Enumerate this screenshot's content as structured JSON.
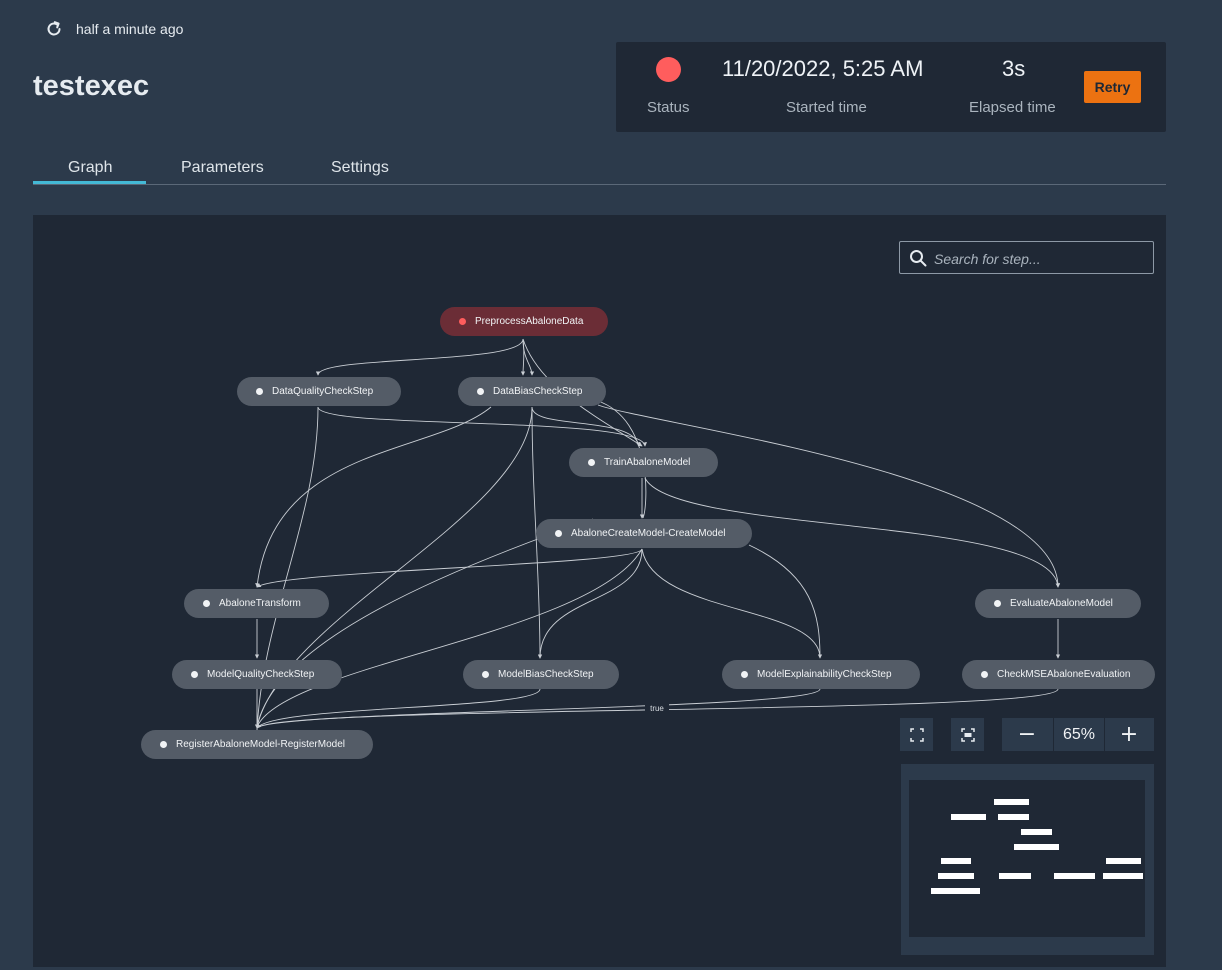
{
  "header": {
    "refresh_label": "half a minute ago",
    "title": "testexec"
  },
  "status_panel": {
    "status_label": "Status",
    "status_color": "#ff5d5d",
    "started_value": "11/20/2022, 5:25 AM",
    "started_label": "Started time",
    "elapsed_value": "3s",
    "elapsed_label": "Elapsed time",
    "retry_label": "Retry",
    "retry_color": "#ec7211"
  },
  "tabs": [
    {
      "label": "Graph",
      "active": true
    },
    {
      "label": "Parameters",
      "active": false
    },
    {
      "label": "Settings",
      "active": false
    }
  ],
  "graph": {
    "search_placeholder": "Search for step...",
    "nodes": [
      {
        "id": "preprocess",
        "label": "PreprocessAbaloneData",
        "status": "failed"
      },
      {
        "id": "dq",
        "label": "DataQualityCheckStep",
        "status": "pending"
      },
      {
        "id": "db",
        "label": "DataBiasCheckStep",
        "status": "pending"
      },
      {
        "id": "train",
        "label": "TrainAbaloneModel",
        "status": "pending"
      },
      {
        "id": "create",
        "label": "AbaloneCreateModel-CreateModel",
        "status": "pending"
      },
      {
        "id": "transform",
        "label": "AbaloneTransform",
        "status": "pending"
      },
      {
        "id": "evaluate",
        "label": "EvaluateAbaloneModel",
        "status": "pending"
      },
      {
        "id": "mq",
        "label": "ModelQualityCheckStep",
        "status": "pending"
      },
      {
        "id": "mb",
        "label": "ModelBiasCheckStep",
        "status": "pending"
      },
      {
        "id": "me",
        "label": "ModelExplainabilityCheckStep",
        "status": "pending"
      },
      {
        "id": "check",
        "label": "CheckMSEAbaloneEvaluation",
        "status": "pending"
      },
      {
        "id": "register",
        "label": "RegisterAbaloneModel-RegisterModel",
        "status": "pending"
      }
    ],
    "edge_label": "true",
    "zoom_level": "65%",
    "zoom_out_label": "−",
    "zoom_in_label": "+"
  }
}
